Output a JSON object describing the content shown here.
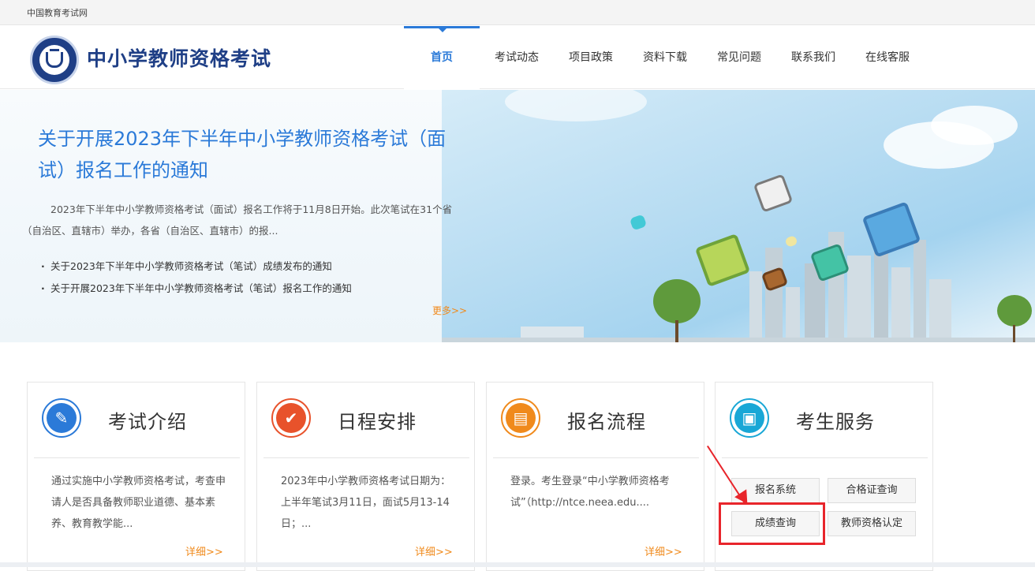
{
  "topbar": {
    "site_name": "中国教育考试网"
  },
  "header": {
    "logo_title": "中小学教师资格考试"
  },
  "nav": {
    "items": [
      "首页",
      "考试动态",
      "项目政策",
      "资料下载",
      "常见问题",
      "联系我们",
      "在线客服"
    ]
  },
  "banner": {
    "title": "关于开展2023年下半年中小学教师资格考试（面试）报名工作的通知",
    "summary": "2023年下半年中小学教师资格考试（面试）报名工作将于11月8日开始。此次笔试在31个省（自治区、直辖市）举办，各省（自治区、直辖市）的报...",
    "news": [
      "关于2023年下半年中小学教师资格考试（笔试）成绩发布的通知",
      "关于开展2023年下半年中小学教师资格考试（笔试）报名工作的通知"
    ],
    "more": "更多>>"
  },
  "cards": [
    {
      "title": "考试介绍",
      "icon": "edit-icon",
      "color": "#2b7ad8",
      "desc": "通过实施中小学教师资格考试，考查申请人是否具备教师职业道德、基本素养、教育教学能...",
      "detail": "详细>>"
    },
    {
      "title": "日程安排",
      "icon": "check-icon",
      "color": "#e8522b",
      "desc": "2023年中小学教师资格考试日期为：上半年笔试3月11日，面试5月13-14日；...",
      "detail": "详细>>"
    },
    {
      "title": "报名流程",
      "icon": "form-icon",
      "color": "#f08a1c",
      "desc": "登录。考生登录“中小学教师资格考试”（http://ntce.neea.edu....",
      "detail": "详细>>"
    },
    {
      "title": "考生服务",
      "icon": "contact-book-icon",
      "color": "#19a7d6"
    }
  ],
  "services": {
    "register": "报名系统",
    "certificate": "合格证查询",
    "score": "成绩查询",
    "certification": "教师资格认定"
  },
  "colors": {
    "brand": "#1f3f86",
    "link": "#2b7ad8",
    "accent": "#f08a1c",
    "annotation": "#e8252b"
  }
}
